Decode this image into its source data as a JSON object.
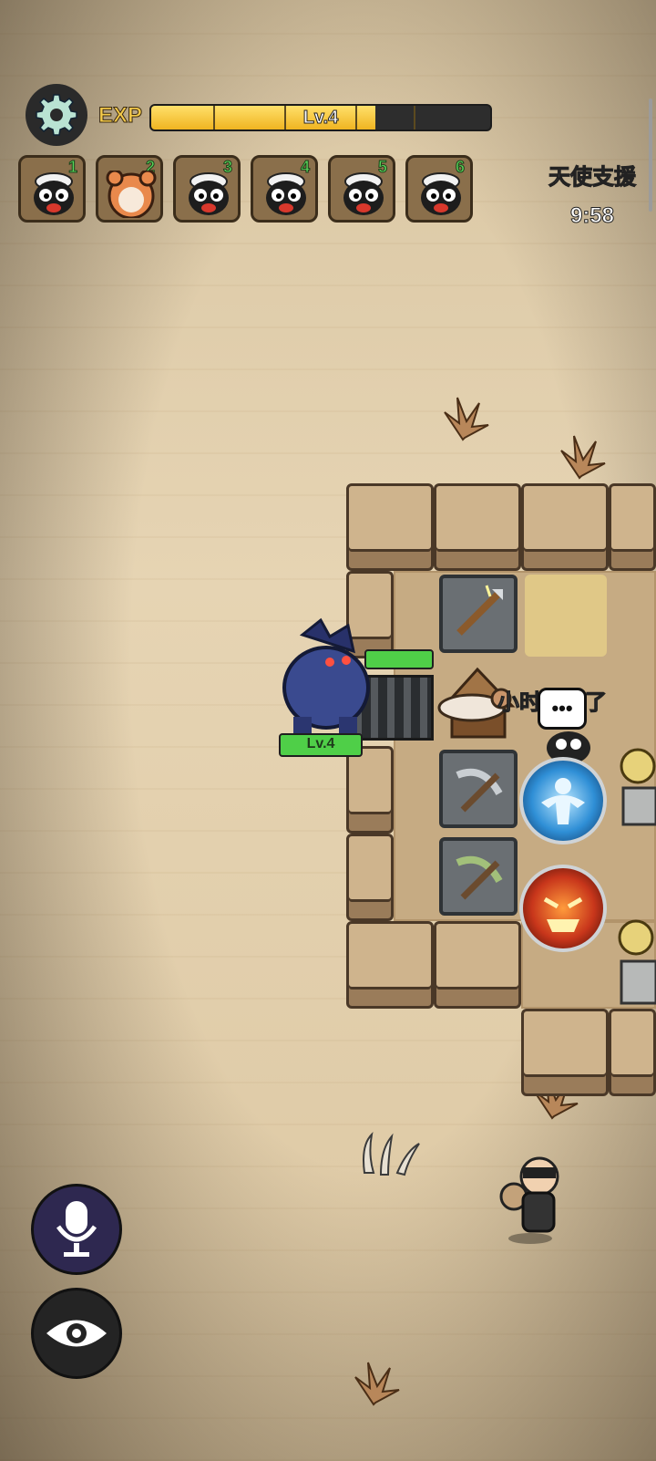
{
  "hud": {
    "exp_label": "EXP",
    "level_text": "Lv.4",
    "exp_progress": 0.66,
    "support_title": "天使支援",
    "support_timer": "9:58"
  },
  "team_slots": [
    {
      "num": "1",
      "icon": "sheep-icon"
    },
    {
      "num": "2",
      "icon": "bear-costume-sheep-icon"
    },
    {
      "num": "3",
      "icon": "sheep-icon"
    },
    {
      "num": "4",
      "icon": "sheep-icon"
    },
    {
      "num": "5",
      "icon": "sheep-icon"
    },
    {
      "num": "6",
      "icon": "sheep-icon"
    }
  ],
  "enemy": {
    "name_icon": "werewolf-icon",
    "level": "Lv.4"
  },
  "speech": {
    "text": "小时候坏了"
  },
  "controls": {
    "mic_icon": "microphone-icon",
    "view_icon": "eye-icon"
  },
  "colors": {
    "exp_fill": "#f0b421",
    "hp_green": "#4fcf48",
    "skill_blue": "#2f8fd6",
    "skill_red": "#c8361b"
  }
}
